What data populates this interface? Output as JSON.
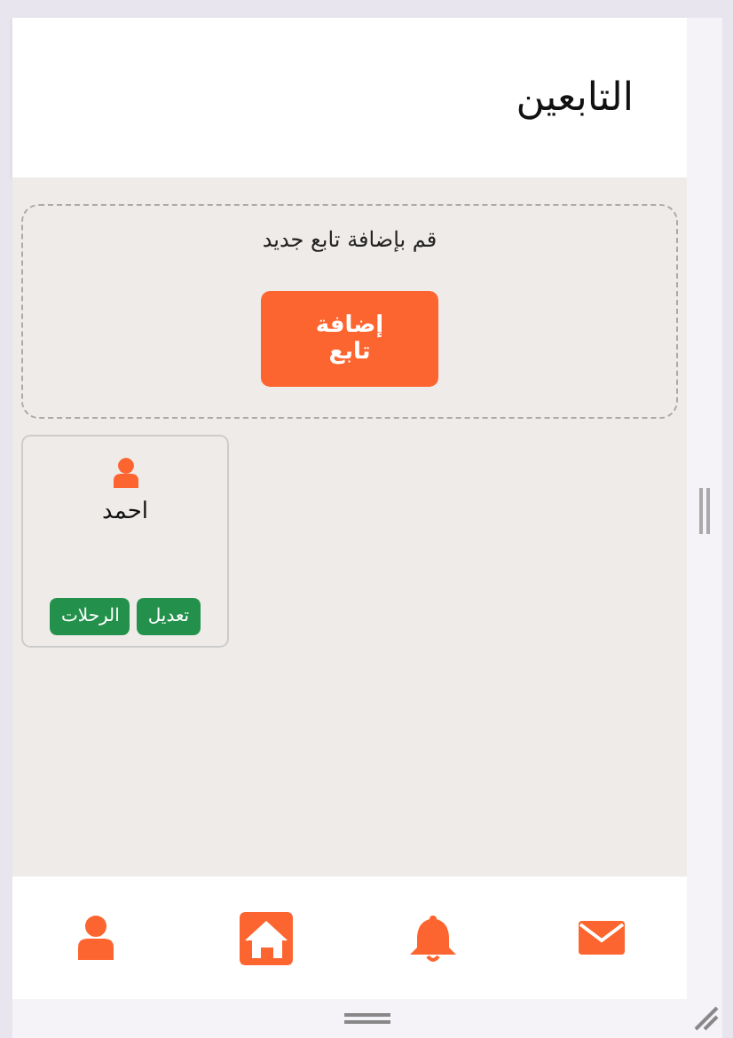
{
  "header": {
    "title": "التابعين"
  },
  "add_panel": {
    "prompt": "قم بإضافة تابع جديد",
    "button": "إضافة تابع"
  },
  "followers": [
    {
      "name": "احمد",
      "actions": [
        "تعديل",
        "الرحلات"
      ]
    }
  ],
  "bottom_nav": [
    {
      "kind": "mail",
      "selected": false
    },
    {
      "kind": "bell",
      "selected": false
    },
    {
      "kind": "home",
      "selected": true
    },
    {
      "kind": "profile",
      "selected": false
    }
  ]
}
